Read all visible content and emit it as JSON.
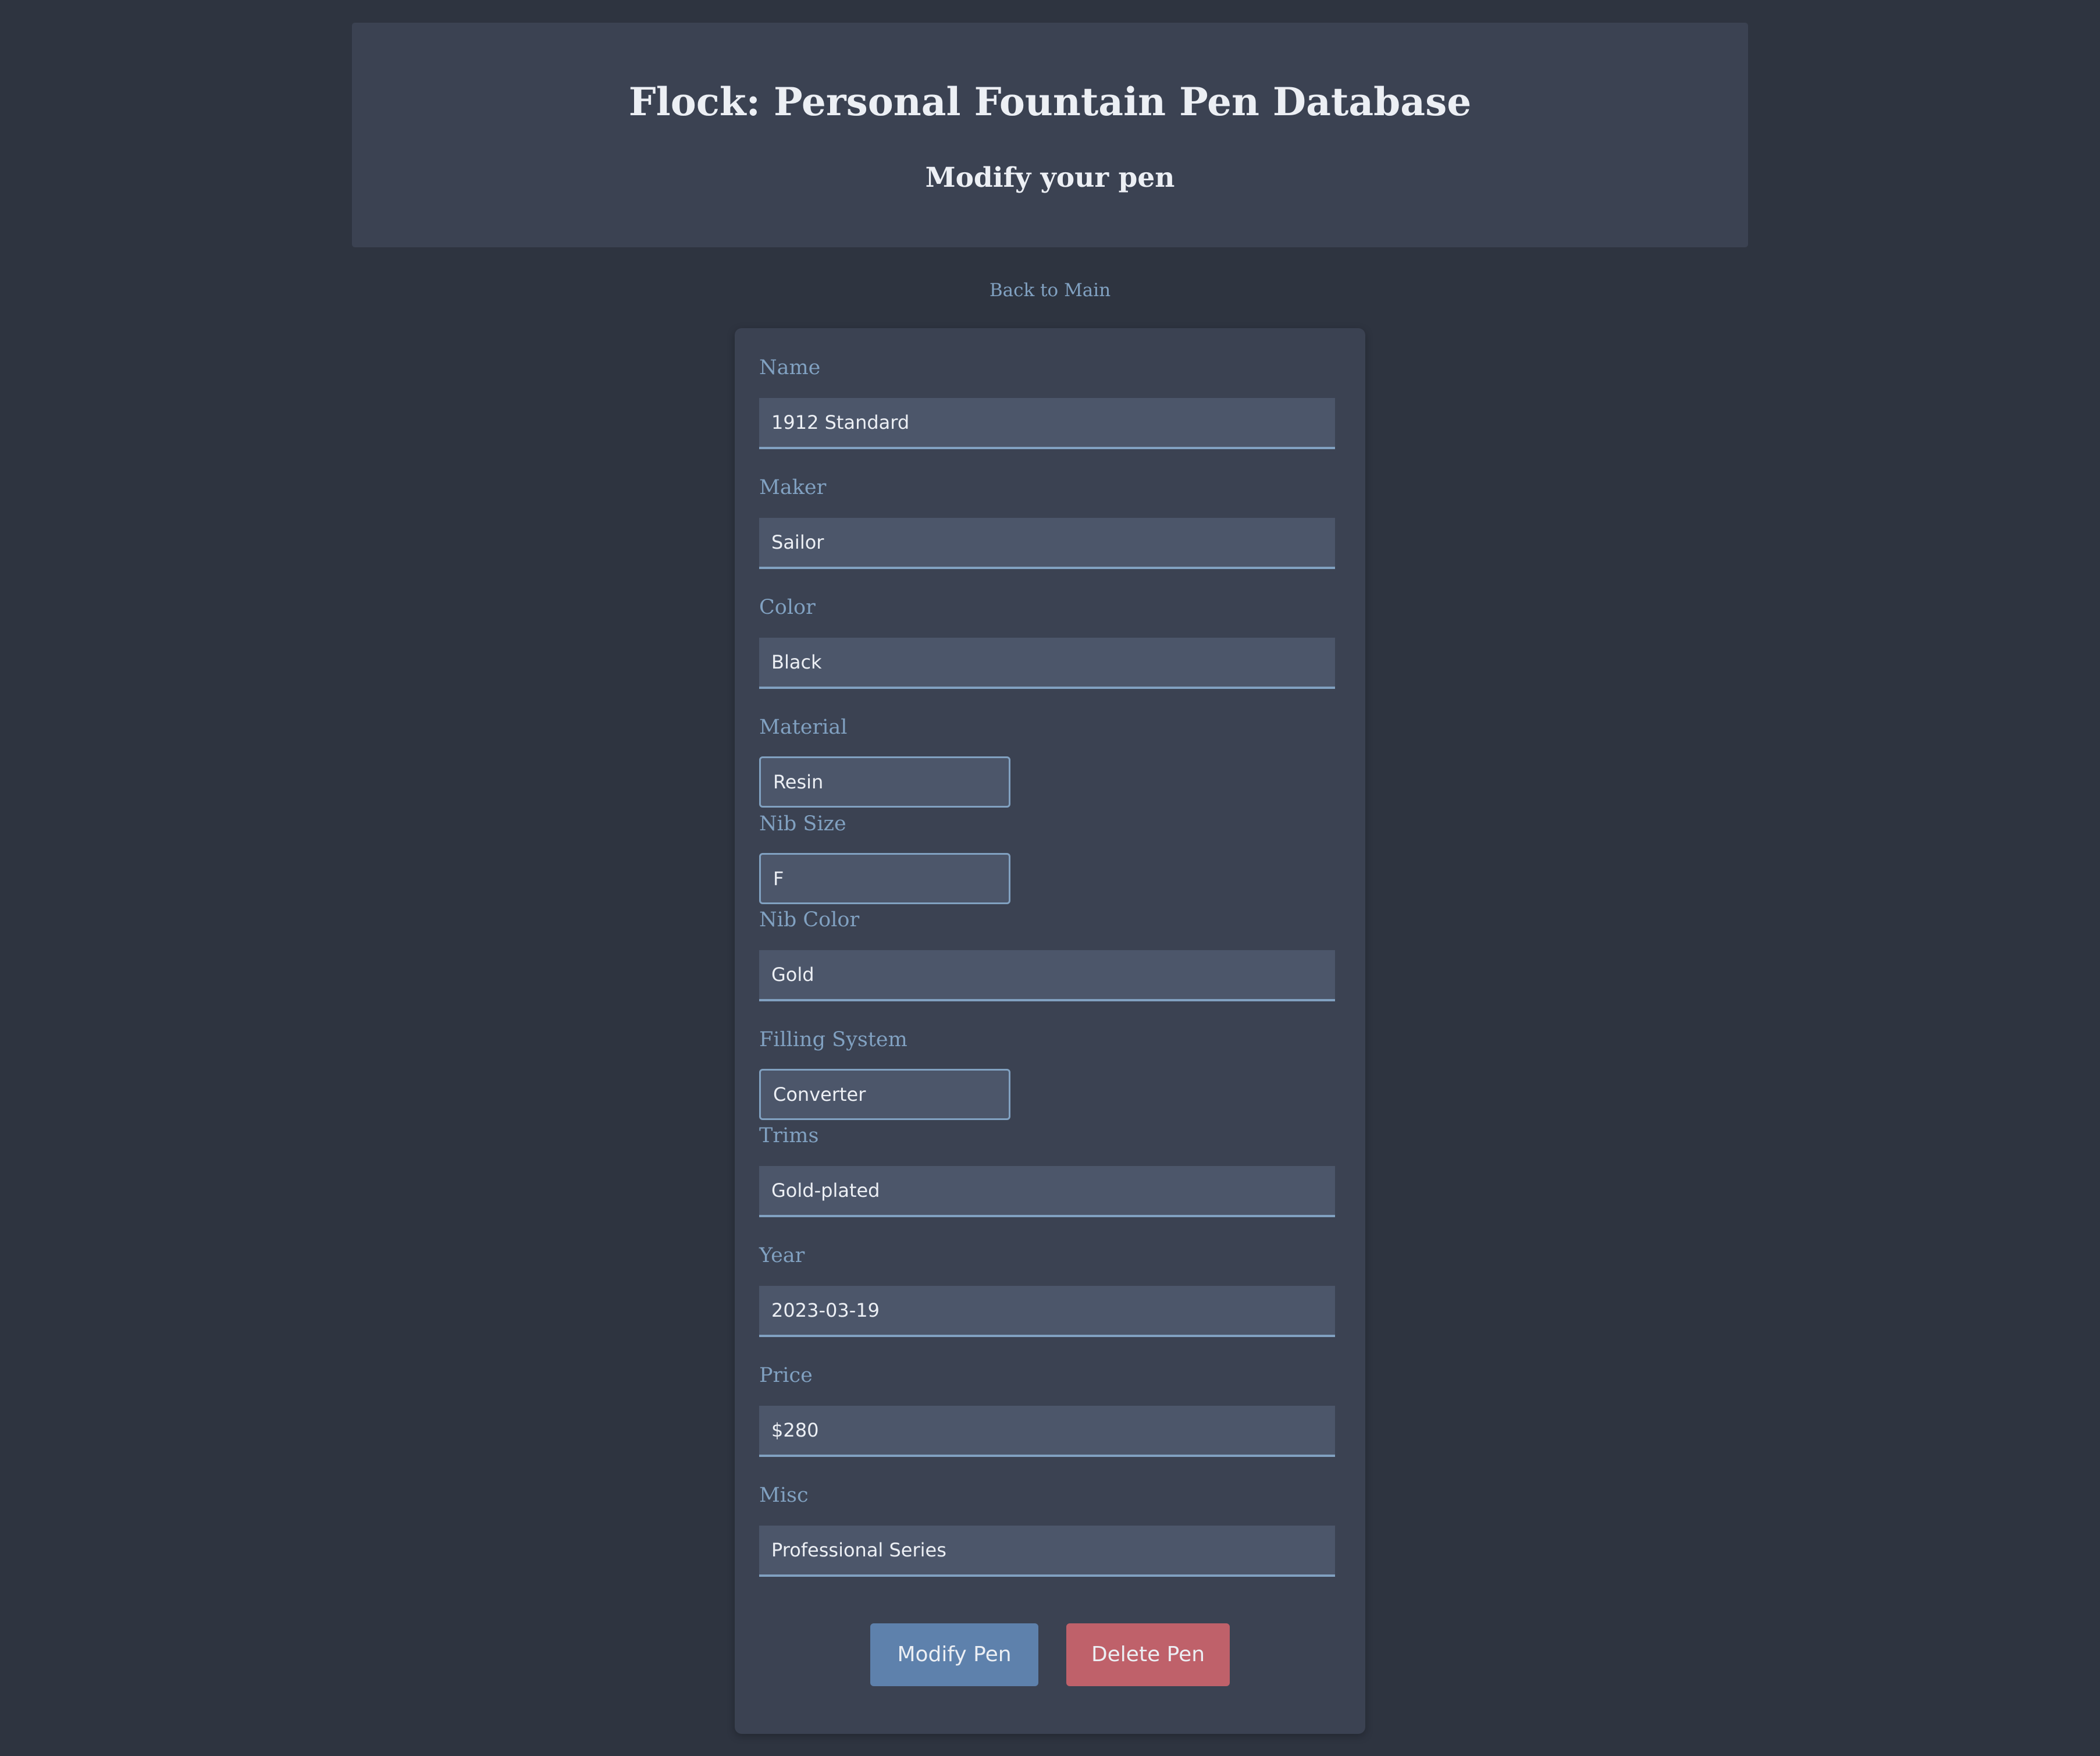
{
  "header": {
    "title": "Flock: Personal Fountain Pen Database",
    "subtitle": "Modify your pen"
  },
  "nav": {
    "back_label": "Back to Main"
  },
  "form": {
    "fields": {
      "name": {
        "label": "Name",
        "value": "1912 Standard"
      },
      "maker": {
        "label": "Maker",
        "value": "Sailor"
      },
      "color": {
        "label": "Color",
        "value": "Black"
      },
      "material": {
        "label": "Material",
        "value": "Resin"
      },
      "nib_size": {
        "label": "Nib Size",
        "value": "F"
      },
      "nib_color": {
        "label": "Nib Color",
        "value": "Gold"
      },
      "filling_system": {
        "label": "Filling System",
        "value": "Converter"
      },
      "trims": {
        "label": "Trims",
        "value": "Gold-plated"
      },
      "year": {
        "label": "Year",
        "value": "2023-03-19"
      },
      "price": {
        "label": "Price",
        "value": "$280"
      },
      "misc": {
        "label": "Misc",
        "value": "Professional Series"
      }
    },
    "modify_label": "Modify Pen",
    "delete_label": "Delete Pen"
  },
  "colors": {
    "background": "#2e3440",
    "panel": "#3b4252",
    "input": "#4c566a",
    "accent": "#81a1c1",
    "primary_button": "#5e81ac",
    "danger_button": "#bf616a",
    "text": "#eceff4"
  }
}
